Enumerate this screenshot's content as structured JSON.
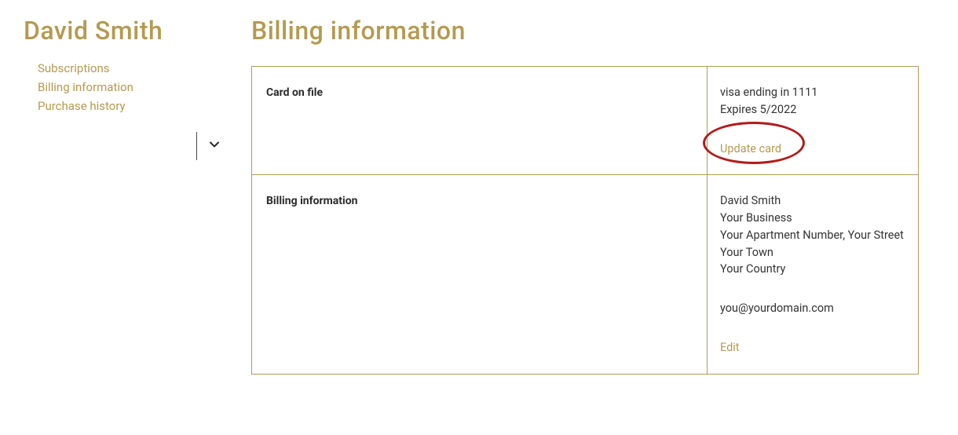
{
  "sidebar": {
    "title": "David Smith",
    "links": {
      "subscriptions": "Subscriptions",
      "billing": "Billing information",
      "purchase_history": "Purchase history"
    }
  },
  "page": {
    "title": "Billing information"
  },
  "card": {
    "label": "Card on file",
    "line1": "visa ending in 1111",
    "line2": "Expires 5/2022",
    "action": "Update card"
  },
  "billing": {
    "label": "Billing information",
    "name": "David Smith",
    "business": "Your Business",
    "street": "Your Apartment Number, Your Street",
    "town": "Your Town",
    "country": "Your Country",
    "email": "you@yourdomain.com",
    "action": "Edit"
  }
}
